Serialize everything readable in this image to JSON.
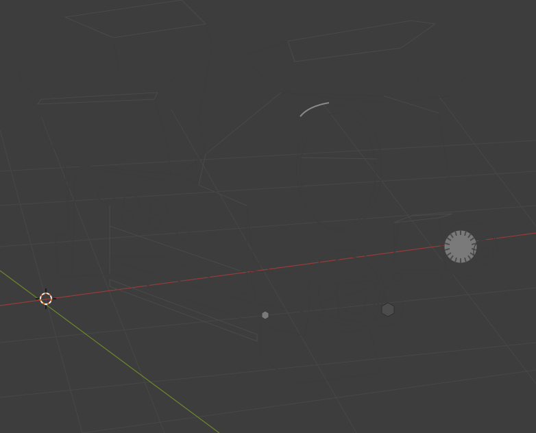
{
  "viewport": {
    "background_color": "#3d3d3d",
    "grid_color": "#474747",
    "x_axis_color": "#9a3b3b",
    "y_axis_color": "#6c8a2a",
    "model_base_color": "#767676",
    "cursor_color": "#e06a2c",
    "icons": {
      "cursor": "3d-cursor-icon"
    }
  }
}
